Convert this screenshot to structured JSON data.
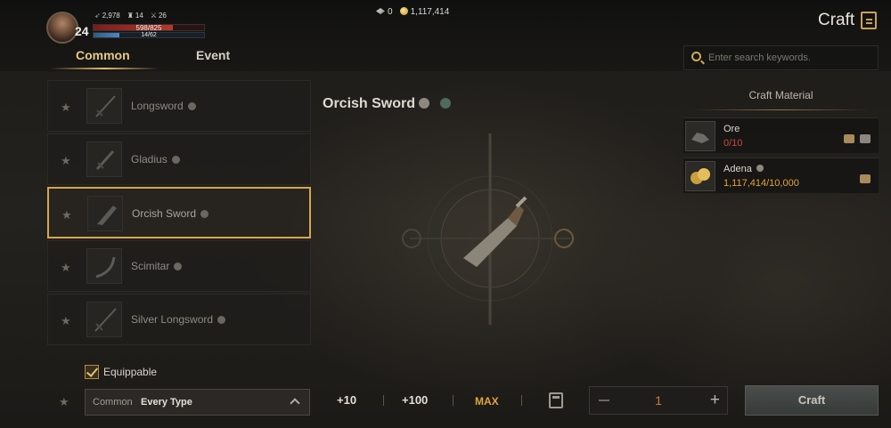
{
  "player": {
    "level": "24",
    "stat_a": "2,978",
    "stat_b": "14",
    "stat_c": "26",
    "hp_text": "598/825",
    "hp_fraction": 0.72,
    "mp_text": "14/62",
    "mp_fraction": 0.23
  },
  "currency": {
    "gems": "0",
    "adena": "1,117,414"
  },
  "header": {
    "title": "Craft"
  },
  "tabs": [
    {
      "label": "Common",
      "active": true
    },
    {
      "label": "Event",
      "active": false
    }
  ],
  "items": [
    {
      "name": "Longsword",
      "icon": "sword-icon"
    },
    {
      "name": "Gladius",
      "icon": "sword-icon"
    },
    {
      "name": "Orcish Sword",
      "icon": "cleaver-sword-icon",
      "selected": true
    },
    {
      "name": "Scimitar",
      "icon": "curved-sword-icon"
    },
    {
      "name": "Silver Longsword",
      "icon": "sword-icon"
    }
  ],
  "filters": {
    "equippable_label": "Equippable",
    "equippable_checked": true,
    "grade": "Common",
    "type": "Every Type"
  },
  "detail": {
    "title": "Orcish Sword"
  },
  "quantity": {
    "plus10": "+10",
    "plus100": "+100",
    "max": "MAX",
    "value": "1",
    "minus_symbol": "−",
    "plus_symbol": "+"
  },
  "craft_button": "Craft",
  "search": {
    "placeholder": "Enter search keywords."
  },
  "materials": {
    "heading": "Craft Material",
    "rows": [
      {
        "name": "Ore",
        "count": "0/10",
        "count_color": "#c9493a",
        "icon": "ore-icon"
      },
      {
        "name": "Adena",
        "count": "1,117,414/10,000",
        "count_color": "#e0a33c",
        "icon": "gold-coins-icon"
      }
    ]
  },
  "colors": {
    "accent": "#d5a64e",
    "active_tab": "#e6c98a"
  }
}
